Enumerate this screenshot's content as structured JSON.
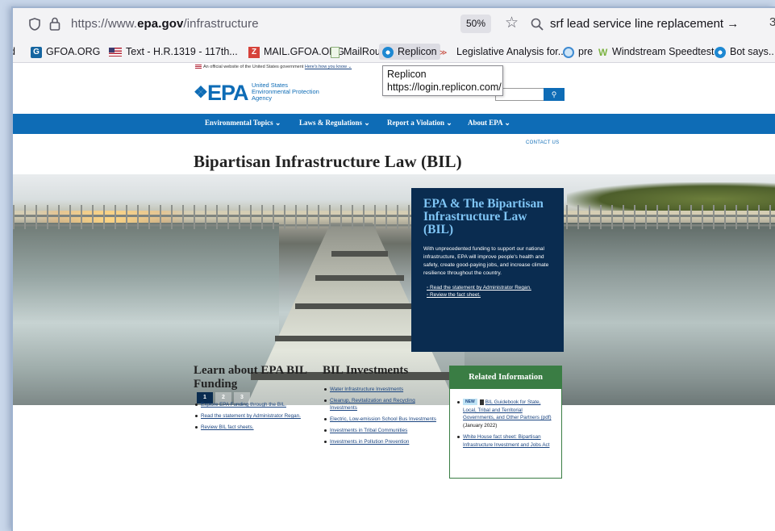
{
  "browser": {
    "url_prefix": "https://www.",
    "url_domain": "epa.gov",
    "url_path": "/infrastructure",
    "zoom": "50%",
    "search_text": "srf lead service line replacement →",
    "extra_icon": "3"
  },
  "bookmarks": [
    {
      "label": "d",
      "icon": "none"
    },
    {
      "label": "GFOA.ORG",
      "icon": "g-logo-icon"
    },
    {
      "label": "Text - H.R.1319 - 117th...",
      "icon": "us-flag-icon"
    },
    {
      "label": "MAIL.GFOA.ORG",
      "icon": "z-logo-icon"
    },
    {
      "label": "MailRoute",
      "icon": "page-icon"
    },
    {
      "label": "Replicon",
      "icon": "replicon-icon"
    },
    {
      "label": "Legislative Analysis for...",
      "icon": "wings-icon"
    },
    {
      "label": "pre",
      "icon": "globe-icon"
    },
    {
      "label": "Windstream Speedtest",
      "icon": "w-logo-icon"
    },
    {
      "label": "Bot says...",
      "icon": "replicon-icon"
    }
  ],
  "tooltip": {
    "title": "Replicon",
    "url": "https://login.replicon.com/"
  },
  "page": {
    "gov_banner": "An official website of the United States government",
    "gov_banner_link": "Here's how you know ⌄",
    "logo_mark": "EPA",
    "logo_line1": "United States",
    "logo_line2": "Environmental Protection",
    "logo_line3": "Agency",
    "nav": [
      "Environmental Topics ⌄",
      "Laws & Regulations ⌄",
      "Report a Violation ⌄",
      "About EPA ⌄"
    ],
    "contact": "CONTACT US",
    "title": "Bipartisan Infrastructure Law (BIL)"
  },
  "hero": {
    "heading": "EPA & The Bipartisan Infrastructure Law (BIL)",
    "body": "With unprecedented funding to support our national infrastructure, EPA will improve people's health and safety, create good-paying jobs, and increase climate resilience throughout the country.",
    "links": [
      "Read the statement by Administrator Regan.",
      "Review the fact sheet."
    ],
    "pages": [
      "1",
      "2",
      "3"
    ]
  },
  "learn": {
    "heading": "Learn about EPA BIL Funding",
    "links": [
      "Explore EPA Funding through the BIL.",
      "Read the statement by Administrator Regan.",
      "Review BIL fact sheets."
    ]
  },
  "investments": {
    "heading": "BIL Investments",
    "links": [
      "Water Infrastructure Investments",
      "Cleanup, Revitalization and Recycling Investments",
      "Electric, Low-emission School Bus Investments",
      "Investments in Tribal Communities",
      "Investments in Pollution Prevention"
    ]
  },
  "related": {
    "heading": "Related Information",
    "item1_badge": "NEW",
    "item1_link": "BIL Guidebook for State, Local, Tribal and Territorial Governments, and Other Partners (pdf)",
    "item1_suffix": " (January 2022)",
    "item2_link": "White House fact sheet: Bipartisan Infrastructure Investment and Jobs Act"
  }
}
